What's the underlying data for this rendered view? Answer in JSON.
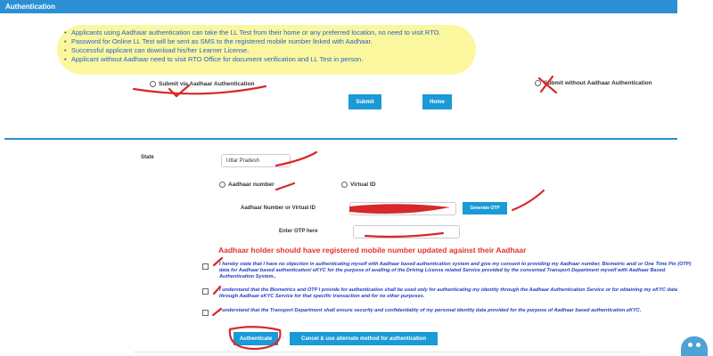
{
  "header": {
    "title": "Authentication"
  },
  "info": {
    "items": [
      "Applicants using Aadhaar authentication can take the LL Test from their home or any preferred location, no need to visit RTO.",
      "Password for Online LL Test will be sent as SMS to the registered mobile number linked with Aadhaar.",
      "Successful applicant can download his/her Learner License.",
      "Applicant without Aadhaar need to visit RTO Office for document verification and LL Test in person."
    ]
  },
  "auth_choice": {
    "with_aadhaar": "Submit via Aadhaar Authentication",
    "without_aadhaar": "Submit without Aadhaar Authentication",
    "submit": "Submit",
    "home": "Home"
  },
  "form": {
    "state_label": "State",
    "state_value": "Uttar Pradesh",
    "id_type_aadhaar": "Aadhaar number",
    "id_type_virtual": "Virtual ID",
    "number_label": "Aadhaar Number or Virtual ID",
    "generate_otp": "Generate OTP",
    "otp_label": "Enter OTP here",
    "warning": "Aadhaar holder should have registered mobile number updated against their Aadhaar",
    "declarations": [
      "I hereby state that I have no objection in authenticating myself with Aadhaar based authentication system and give my consent to providing my Aadhaar number, Biometric and/ or One Time Pin (OTP) data for Aadhaar based authentication/ eKYC for the purpose of availing of the Driving License related Service provided by the concerned Transport Department myself with Aadhaar Based Authentication System..",
      "I understand that the Biometrics and OTP I provide for authentication shall be used only for authenticating my identity through the Aadhaar Authentication Service or for obtaining my eKYC data through Aadhaar eKYC Service for that specific transaction and for no other purposes.",
      "I understand that the Transport Department shall ensure security and confidentiality of my personal identity data provided for the purpose of Aadhaar based authentication eKYC."
    ],
    "authenticate": "Authenticate",
    "cancel": "Cancel & use alternate method for authentication"
  }
}
